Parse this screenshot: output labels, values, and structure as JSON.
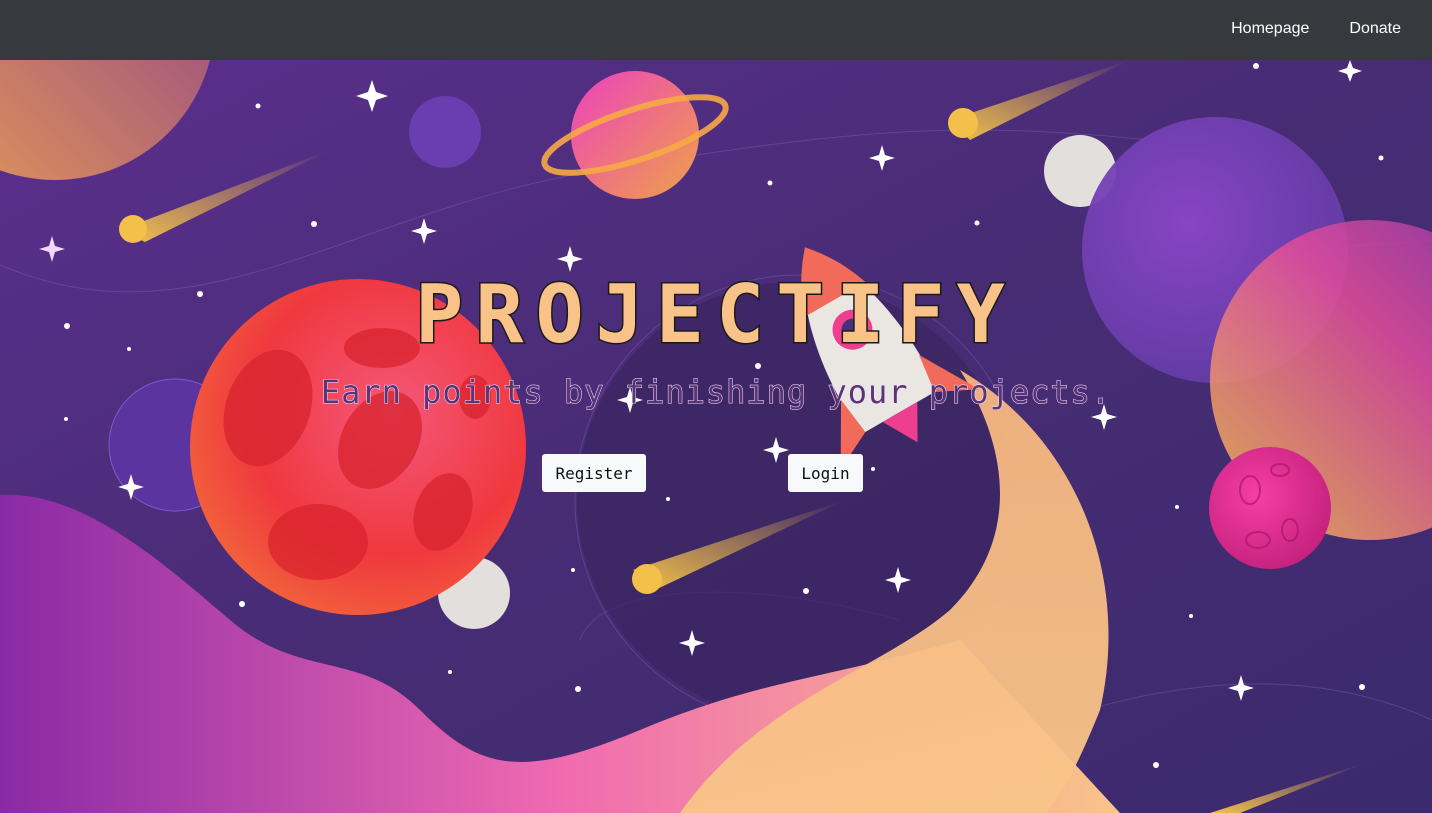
{
  "navbar": {
    "links": [
      "Homepage",
      "Donate"
    ]
  },
  "hero": {
    "title": "PROJECTIFY",
    "subtitle": "Earn points by finishing your projects.",
    "register_label": "Register",
    "login_label": "Login"
  },
  "colors": {
    "navbar_bg": "#363a3f",
    "space_bg": "#4a2f7a",
    "title_fill": "#f9c289",
    "button_bg": "#f8f9fa"
  }
}
